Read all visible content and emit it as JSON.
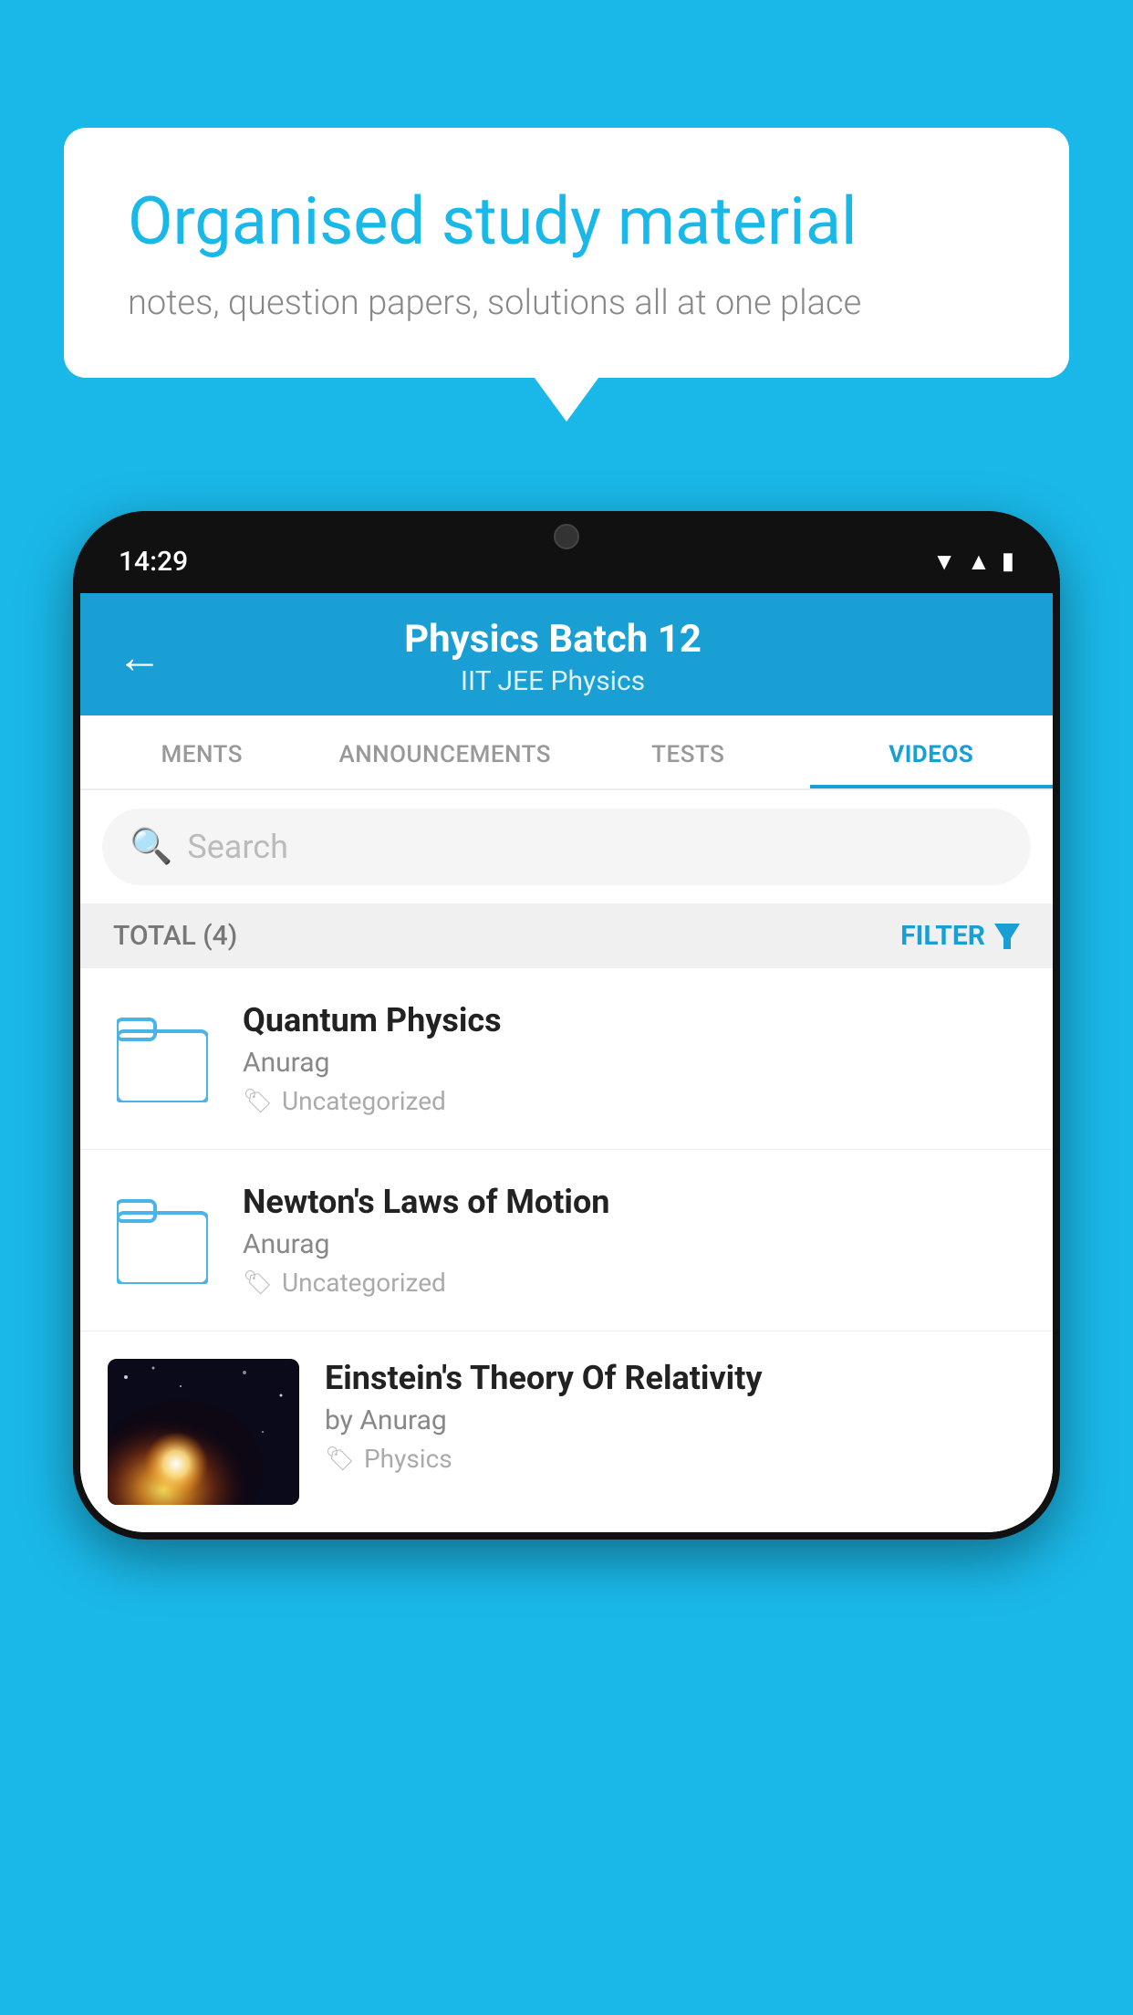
{
  "background_color": "#1ab8e8",
  "speech_bubble": {
    "title": "Organised study material",
    "subtitle": "notes, question papers, solutions all at one place"
  },
  "status_bar": {
    "time": "14:29",
    "icons": [
      "wifi",
      "signal",
      "battery"
    ]
  },
  "app_header": {
    "title": "Physics Batch 12",
    "subtitle": "IIT JEE   Physics",
    "back_label": "←"
  },
  "tabs": [
    {
      "label": "MENTS",
      "active": false
    },
    {
      "label": "ANNOUNCEMENTS",
      "active": false
    },
    {
      "label": "TESTS",
      "active": false
    },
    {
      "label": "VIDEOS",
      "active": true
    }
  ],
  "search": {
    "placeholder": "Search"
  },
  "filter_bar": {
    "total_label": "TOTAL (4)",
    "filter_label": "FILTER"
  },
  "videos": [
    {
      "title": "Quantum Physics",
      "author": "Anurag",
      "tag": "Uncategorized",
      "type": "folder"
    },
    {
      "title": "Newton's Laws of Motion",
      "author": "Anurag",
      "tag": "Uncategorized",
      "type": "folder"
    },
    {
      "title": "Einstein's Theory Of Relativity",
      "author": "by Anurag",
      "tag": "Physics",
      "type": "video"
    }
  ]
}
